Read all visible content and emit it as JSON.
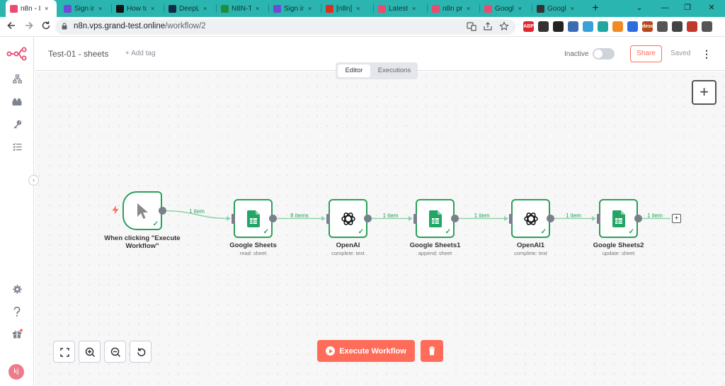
{
  "browser": {
    "tabs": [
      {
        "label": "n8n - I",
        "close": "×",
        "color": "#ea4b71",
        "active": true
      },
      {
        "label": "Sign in",
        "close": "×",
        "color": "#6e4ad6"
      },
      {
        "label": "How to",
        "close": "×",
        "color": "#111111"
      },
      {
        "label": "DeepL",
        "close": "×",
        "color": "#0f2b46"
      },
      {
        "label": "N8N-T",
        "close": "×",
        "color": "#1e8e3e"
      },
      {
        "label": "Sign in",
        "close": "×",
        "color": "#6e4ad6"
      },
      {
        "label": "[n8n]",
        "close": "×",
        "color": "#d93025"
      },
      {
        "label": "Latest",
        "close": "×",
        "color": "#ea4b71"
      },
      {
        "label": "n8n pr",
        "close": "×",
        "color": "#ea4b71"
      },
      {
        "label": "Googl",
        "close": "×",
        "color": "#ea4b71"
      },
      {
        "label": "Googl",
        "close": "×",
        "color": "#333333"
      }
    ],
    "new_tab": "+",
    "window_controls": {
      "dropdown": "⌄",
      "minimize": "—",
      "restore": "❐",
      "close": "✕"
    },
    "url_host": "n8n.vps.grand-test.online",
    "url_path": "/workflow/2",
    "extensions": [
      {
        "name": "adblock-icon",
        "label": "ABP",
        "color": "#e0282e"
      },
      {
        "name": "extension-dark-icon",
        "label": "",
        "color": "#333333"
      },
      {
        "name": "notion-icon",
        "label": "",
        "color": "#222222"
      },
      {
        "name": "picture-icon",
        "label": "",
        "color": "#3b6db3"
      },
      {
        "name": "snowflake-icon",
        "label": "",
        "color": "#3aa0d8"
      },
      {
        "name": "extension-teal-icon",
        "label": "",
        "color": "#1fa7a0"
      },
      {
        "name": "rss-icon",
        "label": "",
        "color": "#f08a24"
      },
      {
        "name": "extension-blue-icon",
        "label": "",
        "color": "#2d6cdf"
      },
      {
        "name": "desc-icon",
        "label": "desc",
        "color": "#b5481c"
      },
      {
        "name": "puzzle-icon",
        "label": "",
        "color": "#555555"
      },
      {
        "name": "sidepanel-icon",
        "label": "",
        "color": "#444444"
      },
      {
        "name": "profile-icon",
        "label": "",
        "color": "#c0392b"
      },
      {
        "name": "menu-icon",
        "label": "",
        "color": "#555555"
      }
    ]
  },
  "app": {
    "accent": "#ff6d5a",
    "success": "#2aa05a",
    "workflow_name": "Test-01 - sheets",
    "add_tag": "+ Add tag",
    "status_label": "Inactive",
    "share_label": "Share",
    "saved_label": "Saved",
    "mode_tabs": {
      "editor": "Editor",
      "executions": "Executions"
    },
    "avatar_initials": "kj",
    "nodes": [
      {
        "name": "When clicking \"Execute Workflow\"",
        "subtitle": "",
        "type": "manual-trigger"
      },
      {
        "name": "Google Sheets",
        "subtitle": "read: sheet",
        "type": "google-sheets"
      },
      {
        "name": "OpenAI",
        "subtitle": "complete: text",
        "type": "openai"
      },
      {
        "name": "Google Sheets1",
        "subtitle": "append: sheet",
        "type": "google-sheets"
      },
      {
        "name": "OpenAI1",
        "subtitle": "complete: text",
        "type": "openai"
      },
      {
        "name": "Google Sheets2",
        "subtitle": "update: sheet",
        "type": "google-sheets"
      }
    ],
    "connections": [
      {
        "from": 0,
        "to": 1,
        "label": "1 item"
      },
      {
        "from": 1,
        "to": 2,
        "label": "8 items"
      },
      {
        "from": 2,
        "to": 3,
        "label": "1 item"
      },
      {
        "from": 3,
        "to": 4,
        "label": "1 item"
      },
      {
        "from": 4,
        "to": 5,
        "label": "1 item"
      },
      {
        "from": 5,
        "to": null,
        "label": "1 item"
      }
    ],
    "execute_label": "Execute Workflow"
  }
}
